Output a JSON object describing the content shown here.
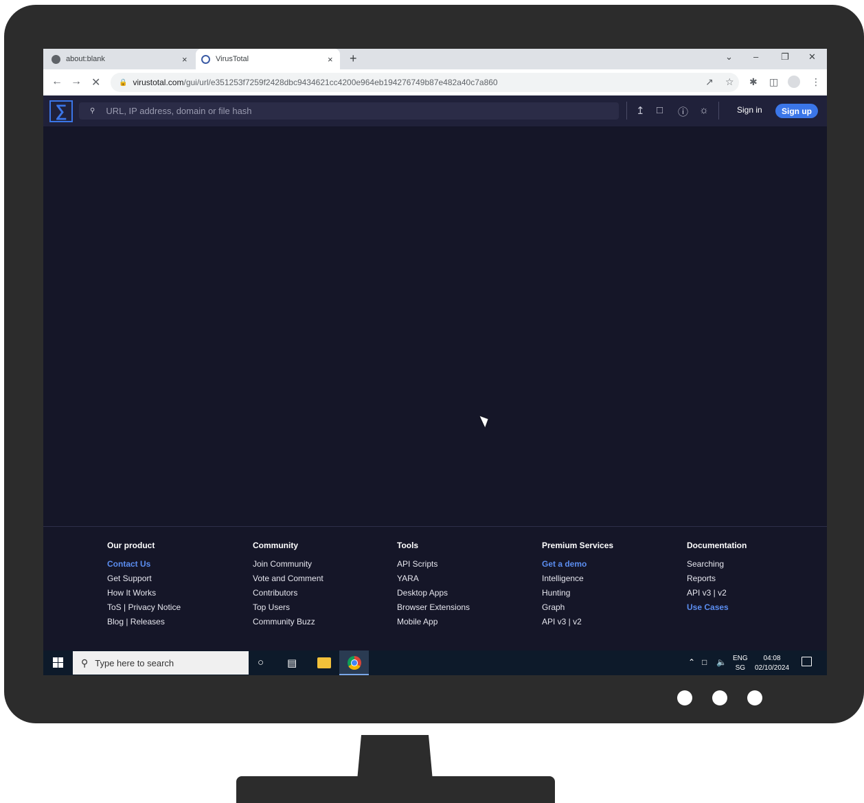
{
  "browser": {
    "tabs": [
      {
        "label": "about:blank",
        "close": "×"
      },
      {
        "label": "VirusTotal",
        "close": "×"
      }
    ],
    "new_tab": "+",
    "window_controls": {
      "menu": "⌄",
      "minimize": "–",
      "restore": "❐",
      "close": "✕"
    },
    "nav": {
      "back": "←",
      "forward": "→",
      "stop": "✕"
    },
    "url_host": "virustotal.com",
    "url_path": "/gui/url/e351253f7259f2428dbc9434621cc4200e964eb194276749b87e482a40c7a860"
  },
  "vt": {
    "logo": "∑",
    "search_placeholder": "URL, IP address, domain or file hash",
    "signin": "Sign in",
    "signup": "Sign up"
  },
  "footer": {
    "columns": [
      {
        "title": "Our product",
        "links": [
          "Contact Us",
          "Get Support",
          "How It Works",
          "ToS | Privacy Notice",
          "Blog | Releases"
        ]
      },
      {
        "title": "Community",
        "links": [
          "Join Community",
          "Vote and Comment",
          "Contributors",
          "Top Users",
          "Community Buzz"
        ]
      },
      {
        "title": "Tools",
        "links": [
          "API Scripts",
          "YARA",
          "Desktop Apps",
          "Browser Extensions",
          "Mobile App"
        ]
      },
      {
        "title": "Premium Services",
        "links": [
          "Get a demo",
          "Intelligence",
          "Hunting",
          "Graph",
          "API v3 | v2"
        ]
      },
      {
        "title": "Documentation",
        "links": [
          "Searching",
          "Reports",
          "API v3 | v2",
          "Use Cases"
        ]
      }
    ]
  },
  "taskbar": {
    "search_placeholder": "Type here to search",
    "lang_top": "ENG",
    "lang_bottom": "SG",
    "time": "04:08",
    "date": "02/10/2024"
  }
}
